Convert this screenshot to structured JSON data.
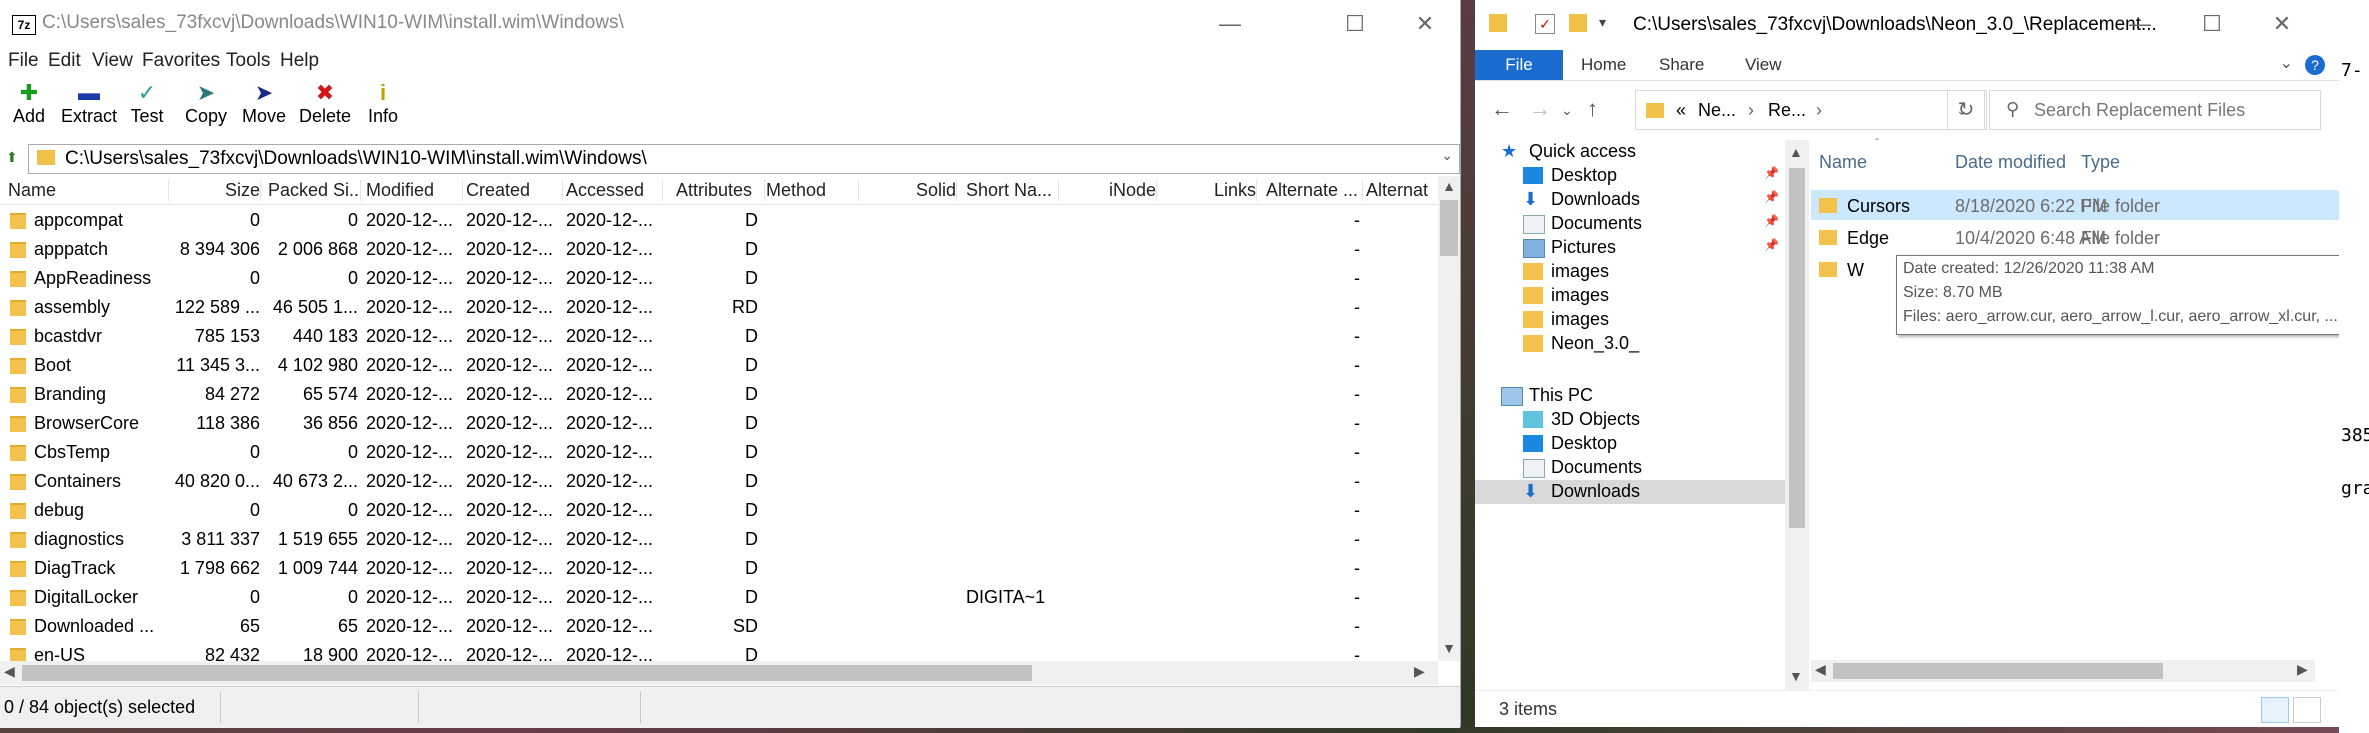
{
  "sevenzip": {
    "title": "C:\\Users\\sales_73fxcvj\\Downloads\\WIN10-WIM\\install.wim\\Windows\\",
    "app_icon": "7z",
    "menu": [
      "File",
      "Edit",
      "View",
      "Favorites",
      "Tools",
      "Help"
    ],
    "toolbar": [
      {
        "label": "Add",
        "icon": "plus-icon",
        "color": "#1a9a1a"
      },
      {
        "label": "Extract",
        "icon": "minus-icon",
        "color": "#1a3aaa"
      },
      {
        "label": "Test",
        "icon": "check-icon",
        "color": "#2aa0a0"
      },
      {
        "label": "Copy",
        "icon": "copy-arrow-icon",
        "color": "#2a7a7a"
      },
      {
        "label": "Move",
        "icon": "move-arrow-icon",
        "color": "#1a2a8a"
      },
      {
        "label": "Delete",
        "icon": "x-icon",
        "color": "#d01818"
      },
      {
        "label": "Info",
        "icon": "info-icon",
        "color": "#c0a000"
      }
    ],
    "path": "C:\\Users\\sales_73fxcvj\\Downloads\\WIN10-WIM\\install.wim\\Windows\\",
    "columns": [
      "Name",
      "Size",
      "Packed Si...",
      "Modified",
      "Created",
      "Accessed",
      "Attributes",
      "Method",
      "Solid",
      "Short Na...",
      "iNode",
      "Links",
      "Alternate ...",
      "Alternat"
    ],
    "rows": [
      {
        "name": "appcompat",
        "size": "0",
        "packed": "0",
        "modified": "2020-12-...",
        "created": "2020-12-...",
        "accessed": "2020-12-...",
        "attr": "D",
        "short": "",
        "alt": "-"
      },
      {
        "name": "apppatch",
        "size": "8 394 306",
        "packed": "2 006 868",
        "modified": "2020-12-...",
        "created": "2020-12-...",
        "accessed": "2020-12-...",
        "attr": "D",
        "short": "",
        "alt": "-"
      },
      {
        "name": "AppReadiness",
        "size": "0",
        "packed": "0",
        "modified": "2020-12-...",
        "created": "2020-12-...",
        "accessed": "2020-12-...",
        "attr": "D",
        "short": "",
        "alt": "-"
      },
      {
        "name": "assembly",
        "size": "122 589 ...",
        "packed": "46 505 1...",
        "modified": "2020-12-...",
        "created": "2020-12-...",
        "accessed": "2020-12-...",
        "attr": "RD",
        "short": "",
        "alt": "-"
      },
      {
        "name": "bcastdvr",
        "size": "785 153",
        "packed": "440 183",
        "modified": "2020-12-...",
        "created": "2020-12-...",
        "accessed": "2020-12-...",
        "attr": "D",
        "short": "",
        "alt": "-"
      },
      {
        "name": "Boot",
        "size": "11 345 3...",
        "packed": "4 102 980",
        "modified": "2020-12-...",
        "created": "2020-12-...",
        "accessed": "2020-12-...",
        "attr": "D",
        "short": "",
        "alt": "-"
      },
      {
        "name": "Branding",
        "size": "84 272",
        "packed": "65 574",
        "modified": "2020-12-...",
        "created": "2020-12-...",
        "accessed": "2020-12-...",
        "attr": "D",
        "short": "",
        "alt": "-"
      },
      {
        "name": "BrowserCore",
        "size": "118 386",
        "packed": "36 856",
        "modified": "2020-12-...",
        "created": "2020-12-...",
        "accessed": "2020-12-...",
        "attr": "D",
        "short": "",
        "alt": "-"
      },
      {
        "name": "CbsTemp",
        "size": "0",
        "packed": "0",
        "modified": "2020-12-...",
        "created": "2020-12-...",
        "accessed": "2020-12-...",
        "attr": "D",
        "short": "",
        "alt": "-"
      },
      {
        "name": "Containers",
        "size": "40 820 0...",
        "packed": "40 673 2...",
        "modified": "2020-12-...",
        "created": "2020-12-...",
        "accessed": "2020-12-...",
        "attr": "D",
        "short": "",
        "alt": "-"
      },
      {
        "name": "debug",
        "size": "0",
        "packed": "0",
        "modified": "2020-12-...",
        "created": "2020-12-...",
        "accessed": "2020-12-...",
        "attr": "D",
        "short": "",
        "alt": "-"
      },
      {
        "name": "diagnostics",
        "size": "3 811 337",
        "packed": "1 519 655",
        "modified": "2020-12-...",
        "created": "2020-12-...",
        "accessed": "2020-12-...",
        "attr": "D",
        "short": "",
        "alt": "-"
      },
      {
        "name": "DiagTrack",
        "size": "1 798 662",
        "packed": "1 009 744",
        "modified": "2020-12-...",
        "created": "2020-12-...",
        "accessed": "2020-12-...",
        "attr": "D",
        "short": "",
        "alt": "-"
      },
      {
        "name": "DigitalLocker",
        "size": "0",
        "packed": "0",
        "modified": "2020-12-...",
        "created": "2020-12-...",
        "accessed": "2020-12-...",
        "attr": "D",
        "short": "DIGITA~1",
        "alt": "-"
      },
      {
        "name": "Downloaded ...",
        "size": "65",
        "packed": "65",
        "modified": "2020-12-...",
        "created": "2020-12-...",
        "accessed": "2020-12-...",
        "attr": "SD",
        "short": "",
        "alt": "-"
      },
      {
        "name": "en-US",
        "size": "82 432",
        "packed": "18 900",
        "modified": "2020-12-...",
        "created": "2020-12-...",
        "accessed": "2020-12-...",
        "attr": "D",
        "short": "",
        "alt": "-"
      }
    ],
    "status": "0 / 84 object(s) selected"
  },
  "explorer": {
    "title": "C:\\Users\\sales_73fxcvj\\Downloads\\Neon_3.0_\\Replacement...",
    "ribbon_tabs": [
      "File",
      "Home",
      "Share",
      "View"
    ],
    "help": "?",
    "breadcrumb": [
      "«",
      "Ne...",
      "Re..."
    ],
    "search_placeholder": "Search Replacement Files",
    "nav": [
      {
        "label": "Quick access",
        "icon": "star-icon",
        "indent": 1,
        "pin": false
      },
      {
        "label": "Desktop",
        "icon": "desktop-icon",
        "indent": 2,
        "pin": true
      },
      {
        "label": "Downloads",
        "icon": "download-icon",
        "indent": 2,
        "pin": true
      },
      {
        "label": "Documents",
        "icon": "documents-icon",
        "indent": 2,
        "pin": true
      },
      {
        "label": "Pictures",
        "icon": "pictures-icon",
        "indent": 2,
        "pin": true
      },
      {
        "label": "images",
        "icon": "folder-icon",
        "indent": 2,
        "pin": false
      },
      {
        "label": "images",
        "icon": "folder-icon",
        "indent": 2,
        "pin": false
      },
      {
        "label": "images",
        "icon": "folder-icon",
        "indent": 2,
        "pin": false
      },
      {
        "label": "Neon_3.0_",
        "icon": "folder-icon",
        "indent": 2,
        "pin": false
      },
      {
        "label": "",
        "icon": "",
        "indent": 0,
        "pin": false
      },
      {
        "label": "This PC",
        "icon": "pc-icon",
        "indent": 1,
        "pin": false
      },
      {
        "label": "3D Objects",
        "icon": "3d-objects-icon",
        "indent": 2,
        "pin": false
      },
      {
        "label": "Desktop",
        "icon": "desktop-icon",
        "indent": 2,
        "pin": false
      },
      {
        "label": "Documents",
        "icon": "documents-icon",
        "indent": 2,
        "pin": false
      },
      {
        "label": "Downloads",
        "icon": "download-icon",
        "indent": 2,
        "pin": false,
        "selected": true
      }
    ],
    "columns": [
      "Name",
      "Date modified",
      "Type"
    ],
    "files": [
      {
        "name": "Cursors",
        "date": "8/18/2020 6:22 PM",
        "type": "File folder",
        "selected": true
      },
      {
        "name": "Edge",
        "date": "10/4/2020 6:48 AM",
        "type": "File folder",
        "selected": false
      },
      {
        "name": "W",
        "date": "",
        "type": "",
        "selected": false
      }
    ],
    "tooltip": [
      "Date created: 12/26/2020 11:38 AM",
      "Size: 8.70 MB",
      "Files: aero_arrow.cur, aero_arrow_l.cur, aero_arrow_xl.cur, ..."
    ],
    "status": "3 items"
  },
  "terminal": {
    "lines": [
      "7-",
      "385",
      "gra"
    ]
  }
}
